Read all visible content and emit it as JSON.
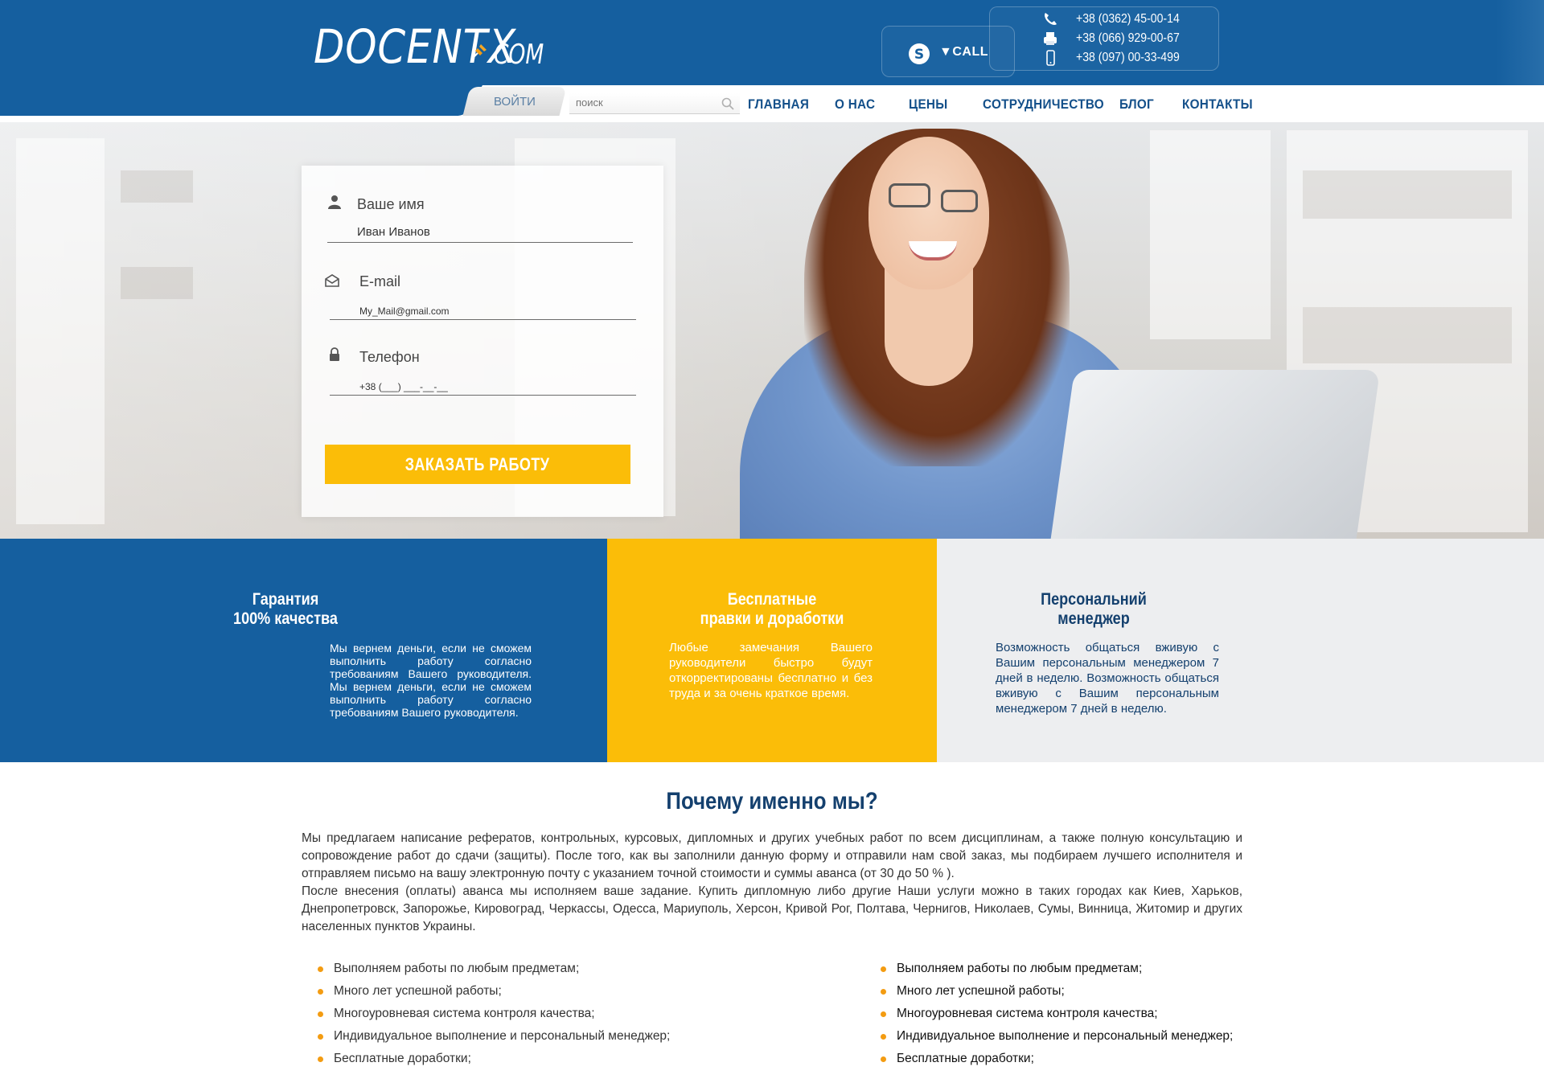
{
  "header": {
    "logo_main": "DOCENTX",
    "logo_suffix": "COM",
    "call_label": "▼CALL",
    "phones": [
      "+38 (0362) 45-00-14",
      "+38 (066) 929-00-67",
      "+38 (097) 00-33-499"
    ]
  },
  "nav": {
    "login_label": "ВОЙТИ",
    "search_placeholder": "поиск",
    "items": [
      "ГЛАВНАЯ",
      "О НАС",
      "ЦЕНЫ",
      "СОТРУДНИЧЕСТВО",
      "БЛОГ",
      "КОНТАКТЫ"
    ]
  },
  "form": {
    "name_label": "Ваше имя",
    "name_value": "Иван Иванов",
    "email_label": "E-mail",
    "email_value": "My_Mail@gmail.com",
    "phone_label": "Телефон",
    "phone_value": "+38 (___) ___-__-__",
    "submit_label": "ЗАКАЗАТЬ РАБОТУ"
  },
  "features": [
    {
      "title_line1": "Гарантия",
      "title_line2": "100% качества",
      "text": "Мы вернем деньги, если не сможем выполнить работу согласно требованиям Вашего руководителя. Мы вернем деньги, если не сможем выполнить работу согласно требованиям Вашего руководителя.",
      "bg": "#155f9f"
    },
    {
      "title_line1": "Бесплатные",
      "title_line2": "правки и доработки",
      "text": "Любые замечания Вашего руководители быстро будут откорректированы бесплатно и без труда и за очень краткое время.",
      "bg": "#fbbd08"
    },
    {
      "title_line1": "Персональний",
      "title_line2": "менеджер",
      "text": "Возможность общаться вживую с Вашим персональным менеджером 7 дней в неделю. Возможность общаться вживую с Вашим персональным менеджером 7 дней в неделю.",
      "bg": "#edeef0"
    }
  ],
  "why": {
    "title": "Почему именно мы?",
    "paragraph1": "Мы предлагаем написание рефератов, контрольных, курсовых, дипломных и других учебных работ по всем дисциплинам, а также полную консультацию и сопровождение работ до сдачи (защиты). После того, как вы заполнили данную форму и отправили нам свой заказ, мы подбираем лучшего исполнителя и отправляем письмо на вашу электронную почту с указанием точной стоимости и суммы аванса (от 30 до 50 % ).",
    "paragraph2": "После внесения (оплаты) аванса мы исполняем ваше задание. Купить дипломную либо другие Наши услуги можно в таких городах как Киев, Харьков, Днепропетровск, Запорожье, Кировоград, Черкассы, Одесса, Мариуполь, Херсон, Кривой Рог, Полтава, Чернигов, Николаев, Сумы, Винница, Житомир и других населенных пунктов Украины.",
    "bullets_left": [
      "Выполняем работы по любым предметам;",
      "Много лет успешной работы;",
      "Многоуровневая система контроля качества;",
      "Индивидуальное выполнение и персональный менеджер;",
      "Бесплатные доработки;"
    ],
    "bullets_right": [
      "Выполняем работы по любым предметам;",
      "Много лет успешной работы;",
      "Многоуровневая система контроля качества;",
      "Индивидуальное выполнение и персональный менеджер;",
      "Бесплатные доработки;"
    ]
  },
  "colors": {
    "brand_blue": "#155f9f",
    "accent_yellow": "#fbbd08",
    "nav_text": "#14508a",
    "bullet_orange": "#f39c12"
  }
}
